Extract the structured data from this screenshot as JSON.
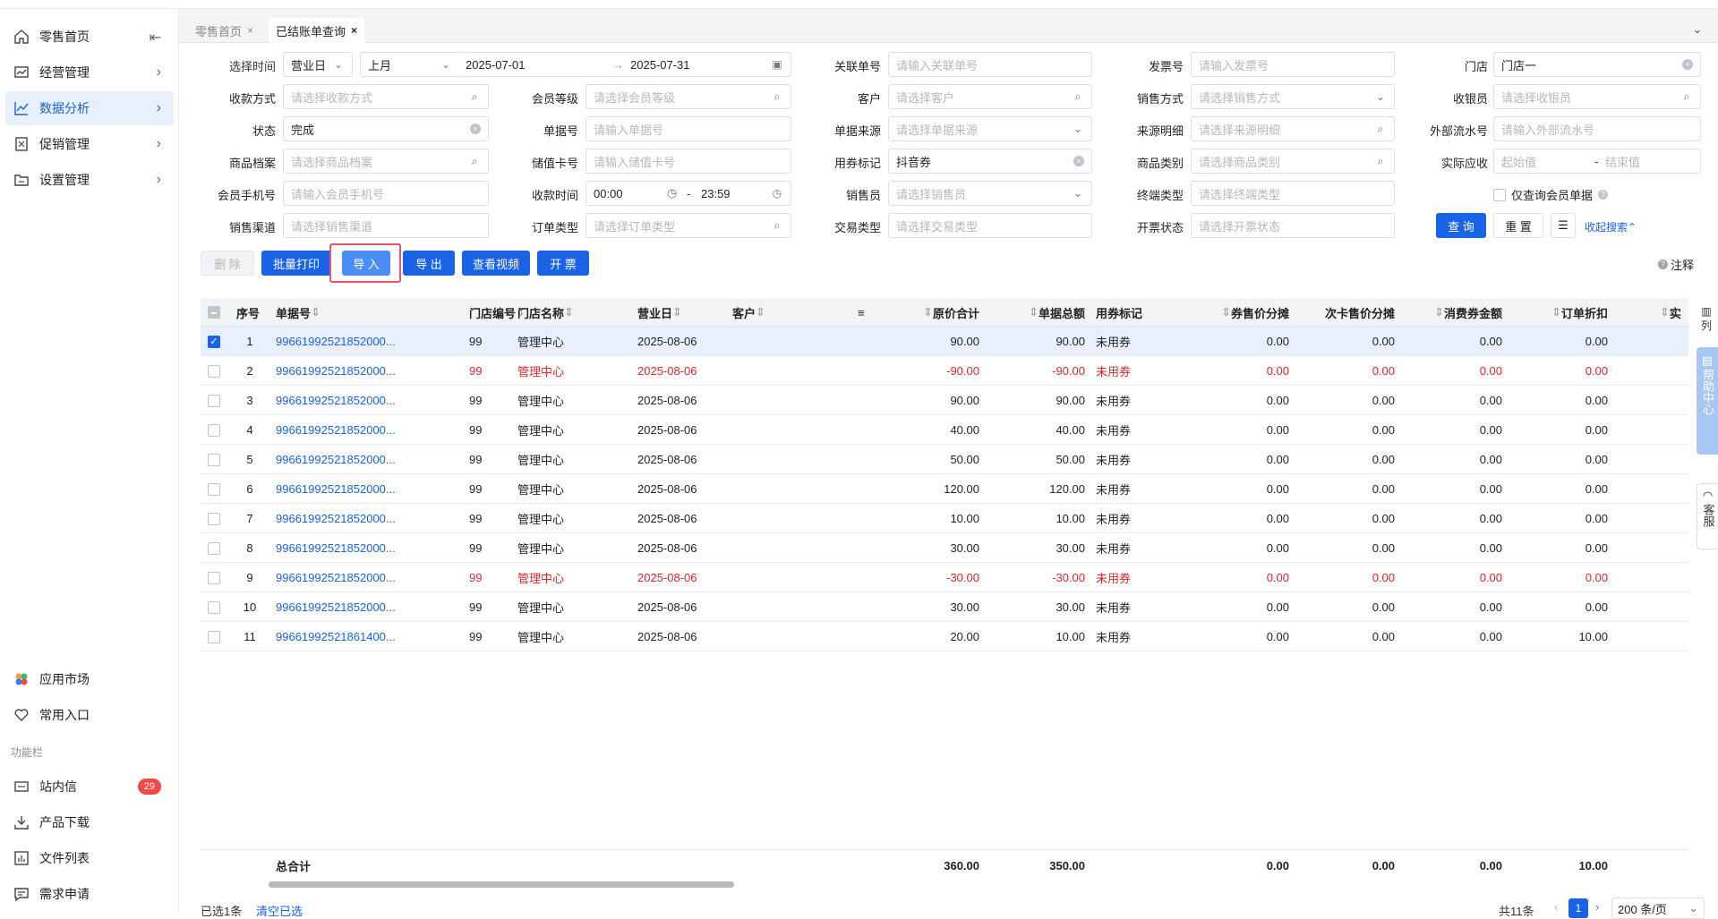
{
  "sidebar": {
    "items": [
      {
        "label": "零售首页",
        "icon": "home-icon"
      },
      {
        "label": "经营管理",
        "icon": "chart-board-icon"
      },
      {
        "label": "数据分析",
        "icon": "line-chart-icon"
      },
      {
        "label": "促销管理",
        "icon": "promo-icon"
      },
      {
        "label": "设置管理",
        "icon": "folder-icon"
      }
    ],
    "bottom_items": [
      {
        "label": "应用市场"
      },
      {
        "label": "常用入口"
      }
    ],
    "section_label": "功能栏",
    "func_items": [
      {
        "label": "站内信",
        "badge": "29"
      },
      {
        "label": "产品下载"
      },
      {
        "label": "文件列表"
      },
      {
        "label": "需求申请"
      }
    ]
  },
  "tabs": [
    {
      "label": "零售首页",
      "close": "×"
    },
    {
      "label": "已结账单查询",
      "close": "×"
    }
  ],
  "filters": {
    "select_time_label": "选择时间",
    "time_type": "营业日",
    "period": "上月",
    "date_start": "2025-07-01",
    "date_sep": "→",
    "date_end": "2025-07-31",
    "related_no_label": "关联单号",
    "related_no_ph": "请输入关联单号",
    "invoice_no_label": "发票号",
    "invoice_no_ph": "请输入发票号",
    "store_label": "门店",
    "store_value": "门店一",
    "pay_method_label": "收款方式",
    "pay_method_ph": "请选择收款方式",
    "member_level_label": "会员等级",
    "member_level_ph": "请选择会员等级",
    "customer_label": "客户",
    "customer_ph": "请选择客户",
    "sale_method_label": "销售方式",
    "sale_method_ph": "请选择销售方式",
    "cashier_label": "收银员",
    "cashier_ph": "请选择收银员",
    "status_label": "状态",
    "status_value": "完成",
    "doc_no_label": "单据号",
    "doc_no_ph": "请输入单据号",
    "doc_source_label": "单据来源",
    "doc_source_ph": "请选择单据来源",
    "source_detail_label": "来源明细",
    "source_detail_ph": "请选择来源明细",
    "ext_serial_label": "外部流水号",
    "ext_serial_ph": "请输入外部流水号",
    "goods_label": "商品档案",
    "goods_ph": "请选择商品档案",
    "stored_card_label": "储值卡号",
    "stored_card_ph": "请输入储值卡号",
    "coupon_flag_label": "用券标记",
    "coupon_flag_value": "抖音券",
    "goods_cat_label": "商品类别",
    "goods_cat_ph": "请选择商品类别",
    "actual_due_label": "实际应收",
    "actual_due_start_ph": "起始值",
    "actual_due_sep": "-",
    "actual_due_end_ph": "结束值",
    "member_phone_label": "会员手机号",
    "member_phone_ph": "请输入会员手机号",
    "collect_time_label": "收款时间",
    "collect_time_start": "00:00",
    "collect_time_sep": "-",
    "collect_time_end": "23:59",
    "salesman_label": "销售员",
    "salesman_ph": "请选择销售员",
    "terminal_type_label": "终端类型",
    "terminal_type_ph": "请选择终端类型",
    "member_only_label": "仅查询会员单据",
    "channel_label": "销售渠道",
    "channel_ph": "请选择销售渠道",
    "order_type_label": "订单类型",
    "order_type_ph": "请选择订单类型",
    "trade_type_label": "交易类型",
    "trade_type_ph": "请选择交易类型",
    "invoice_status_label": "开票状态",
    "invoice_status_ph": "请选择开票状态",
    "query_btn": "查 询",
    "reset_btn": "重 置",
    "collapse_link": "收起搜索"
  },
  "toolbar": {
    "delete": "删 除",
    "batch_print": "批量打印",
    "import": "导 入",
    "export": "导 出",
    "view_video": "查看视频",
    "invoice": "开 票",
    "note": "注释"
  },
  "table": {
    "columns": [
      "序号",
      "单据号",
      "门店编号",
      "门店名称",
      "营业日",
      "客户",
      "原价合计",
      "单据总额",
      "用券标记",
      "券售价分摊",
      "次卡售价分摊",
      "消费券金额",
      "订单折扣",
      "实"
    ],
    "rows": [
      {
        "no": "1",
        "doc": "99661992521852000...",
        "store_no": "99",
        "store_name": "管理中心",
        "day": "2025-08-06",
        "orig": "90.00",
        "total": "90.00",
        "coupon": "未用券",
        "c1": "0.00",
        "c2": "0.00",
        "c3": "0.00",
        "c4": "0.00",
        "red": false,
        "selected": true
      },
      {
        "no": "2",
        "doc": "99661992521852000...",
        "store_no": "99",
        "store_name": "管理中心",
        "day": "2025-08-06",
        "orig": "-90.00",
        "total": "-90.00",
        "coupon": "未用券",
        "c1": "0.00",
        "c2": "0.00",
        "c3": "0.00",
        "c4": "0.00",
        "red": true,
        "selected": false
      },
      {
        "no": "3",
        "doc": "99661992521852000...",
        "store_no": "99",
        "store_name": "管理中心",
        "day": "2025-08-06",
        "orig": "90.00",
        "total": "90.00",
        "coupon": "未用券",
        "c1": "0.00",
        "c2": "0.00",
        "c3": "0.00",
        "c4": "0.00",
        "red": false,
        "selected": false
      },
      {
        "no": "4",
        "doc": "99661992521852000...",
        "store_no": "99",
        "store_name": "管理中心",
        "day": "2025-08-06",
        "orig": "40.00",
        "total": "40.00",
        "coupon": "未用券",
        "c1": "0.00",
        "c2": "0.00",
        "c3": "0.00",
        "c4": "0.00",
        "red": false,
        "selected": false
      },
      {
        "no": "5",
        "doc": "99661992521852000...",
        "store_no": "99",
        "store_name": "管理中心",
        "day": "2025-08-06",
        "orig": "50.00",
        "total": "50.00",
        "coupon": "未用券",
        "c1": "0.00",
        "c2": "0.00",
        "c3": "0.00",
        "c4": "0.00",
        "red": false,
        "selected": false
      },
      {
        "no": "6",
        "doc": "99661992521852000...",
        "store_no": "99",
        "store_name": "管理中心",
        "day": "2025-08-06",
        "orig": "120.00",
        "total": "120.00",
        "coupon": "未用券",
        "c1": "0.00",
        "c2": "0.00",
        "c3": "0.00",
        "c4": "0.00",
        "red": false,
        "selected": false
      },
      {
        "no": "7",
        "doc": "99661992521852000...",
        "store_no": "99",
        "store_name": "管理中心",
        "day": "2025-08-06",
        "orig": "10.00",
        "total": "10.00",
        "coupon": "未用券",
        "c1": "0.00",
        "c2": "0.00",
        "c3": "0.00",
        "c4": "0.00",
        "red": false,
        "selected": false
      },
      {
        "no": "8",
        "doc": "99661992521852000...",
        "store_no": "99",
        "store_name": "管理中心",
        "day": "2025-08-06",
        "orig": "30.00",
        "total": "30.00",
        "coupon": "未用券",
        "c1": "0.00",
        "c2": "0.00",
        "c3": "0.00",
        "c4": "0.00",
        "red": false,
        "selected": false
      },
      {
        "no": "9",
        "doc": "99661992521852000...",
        "store_no": "99",
        "store_name": "管理中心",
        "day": "2025-08-06",
        "orig": "-30.00",
        "total": "-30.00",
        "coupon": "未用券",
        "c1": "0.00",
        "c2": "0.00",
        "c3": "0.00",
        "c4": "0.00",
        "red": true,
        "selected": false
      },
      {
        "no": "10",
        "doc": "99661992521852000...",
        "store_no": "99",
        "store_name": "管理中心",
        "day": "2025-08-06",
        "orig": "30.00",
        "total": "30.00",
        "coupon": "未用券",
        "c1": "0.00",
        "c2": "0.00",
        "c3": "0.00",
        "c4": "0.00",
        "red": false,
        "selected": false
      },
      {
        "no": "11",
        "doc": "99661992521861400...",
        "store_no": "99",
        "store_name": "管理中心",
        "day": "2025-08-06",
        "orig": "20.00",
        "total": "10.00",
        "coupon": "未用券",
        "c1": "0.00",
        "c2": "0.00",
        "c3": "0.00",
        "c4": "10.00",
        "red": false,
        "selected": false
      }
    ],
    "total_label": "总合计",
    "totals": {
      "orig": "360.00",
      "total": "350.00",
      "c1": "0.00",
      "c2": "0.00",
      "c3": "0.00",
      "c4": "10.00"
    }
  },
  "footer": {
    "selected_text": "已选1条",
    "clear_link": "清空已选",
    "total_text": "共11条",
    "page": "1",
    "page_size": "200 条/页"
  },
  "side_float": {
    "columns_label": "列",
    "help_label": "帮助中心",
    "service_label": "客服"
  },
  "colors": {
    "primary": "#1a62e6",
    "negative": "#e0262b",
    "highlight_border": "#f0506e"
  }
}
